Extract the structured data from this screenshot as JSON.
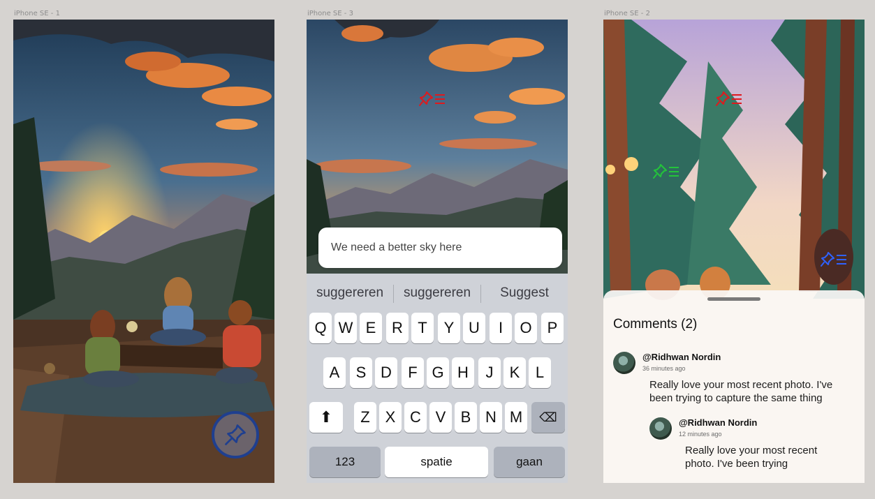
{
  "frames": [
    {
      "label": "iPhone SE - 1"
    },
    {
      "label": "iPhone SE - 3"
    },
    {
      "label": "iPhone SE - 2"
    }
  ],
  "colors": {
    "canvas": "#d6d3d0",
    "pin_red": "#e0191d",
    "pin_green": "#23c43a",
    "pin_blue": "#2f62ff",
    "fab_ring": "#1f3f8f"
  },
  "icons": {
    "fab": "pin-icon",
    "pins": [
      "pin-list-icon"
    ]
  },
  "comment_input": {
    "value": "We need a better sky here"
  },
  "keyboard": {
    "suggestions": [
      "suggereren",
      "suggereren",
      "Suggest"
    ],
    "row1": [
      "Q",
      "W",
      "E",
      "R",
      "T",
      "Y",
      "U",
      "I",
      "O",
      "P"
    ],
    "row2": [
      "A",
      "S",
      "D",
      "F",
      "G",
      "H",
      "J",
      "K",
      "L"
    ],
    "row3": [
      "Z",
      "X",
      "C",
      "V",
      "B",
      "N",
      "M"
    ],
    "shift_glyph": "⬆",
    "backspace_glyph": "⌫",
    "numbers_key": "123",
    "space_key": "spatie",
    "go_key": "gaan"
  },
  "comments_panel": {
    "title": "Comments (2)",
    "comments": [
      {
        "author": "@Ridhwan Nordin",
        "time": "36 minutes ago",
        "body": "Really love your most recent photo. I've been trying to capture the same thing"
      },
      {
        "author": "@Ridhwan Nordin",
        "time": "12 minutes ago",
        "body": "Really love your most recent photo. I've been trying"
      }
    ]
  }
}
